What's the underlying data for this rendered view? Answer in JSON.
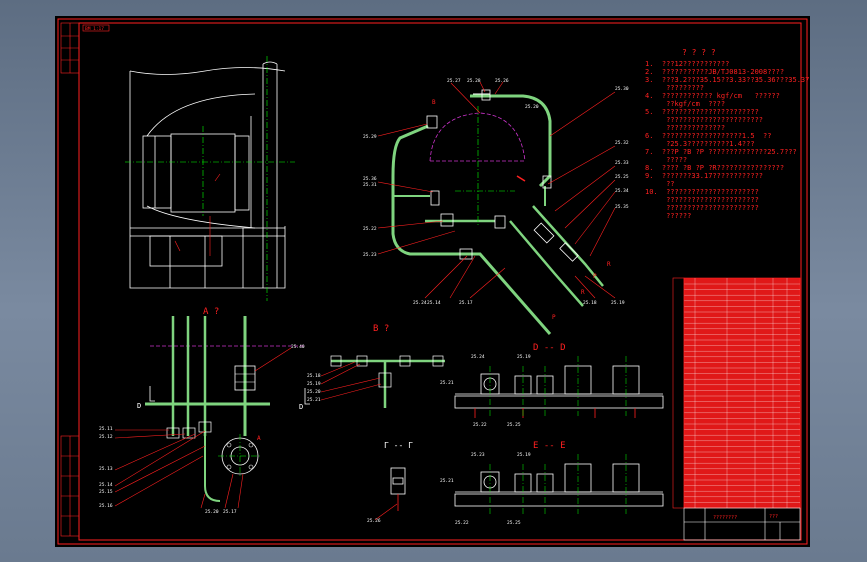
{
  "sheet": {
    "stamp_left": "BM 1:17",
    "stamp_bottom": "BM 1:17"
  },
  "section_titles": {
    "a": "A ?",
    "b": "B ?",
    "d": "D -- D",
    "e": "E -- E",
    "g": "Г -- Г"
  },
  "view_letters": {
    "d_mark": "D",
    "d_mark2": "D",
    "a_mark": "A",
    "b_mark": "B",
    "r_mark": "R",
    "p_mark": "P",
    "p_mark2": "P",
    "r_mark2": "R",
    "f_mark": "F"
  },
  "part_labels": {
    "top_main": [
      "25.27",
      "25.28",
      "25.26",
      "25.30",
      "25.29",
      "25.32",
      "25.33",
      "25.25",
      "25.34",
      "25.35",
      "25.36",
      "25.31",
      "25.22",
      "25.23",
      "25.24",
      "25.14",
      "25.17",
      "25.18",
      "25.19",
      "25.20"
    ],
    "view_a": [
      "25.40",
      "25.11",
      "25.12",
      "25.13",
      "25.14",
      "25.15",
      "25.16",
      "25.20",
      "25.17"
    ],
    "view_b": [
      "25.18",
      "25.19",
      "25.20",
      "25.21"
    ],
    "view_d": [
      "25.21",
      "25.24",
      "25.19",
      "25.22",
      "25.25"
    ],
    "view_e": [
      "25.21",
      "25.23",
      "25.19",
      "25.22",
      "25.25"
    ],
    "view_g": [
      "25.26"
    ]
  },
  "technical_notes": {
    "heading": "? ? ? ?",
    "lines": [
      "1.  ???12???????????",
      "2.  ???????????JB/TJ0813-2008????",
      "3.  ???3.2???35.15??3.33??35.36???35.37",
      "     ?????????",
      "4.  ???????????? kgf/cm   ??????",
      "     ??kgf/cm  ????",
      "5.  ???????????????????????",
      "     ???????????????????????",
      "     ??????????????",
      "6.  ???????????????????1.5  ??",
      "     ?25.3??????????1.4???",
      "7.  ???P ?B ?P ??????????????25.7???",
      "     ?????",
      "8.  ???? ?B ?P ?R????????????????",
      "9.  ???????33.17????????????",
      "     ??",
      "10.  ??????????????????????",
      "     ??????????????????????",
      "     ??????????????????????",
      "     ??????"
    ]
  },
  "title_block": {
    "drawing_title": "????????",
    "drawing_no": "???"
  },
  "colors": {
    "outline": "#ff2020",
    "geometry": "#ffffff",
    "pipe": "#7fd47f",
    "centerline": "#00ff00",
    "hidden": "#cc33cc",
    "background": "#000000"
  }
}
